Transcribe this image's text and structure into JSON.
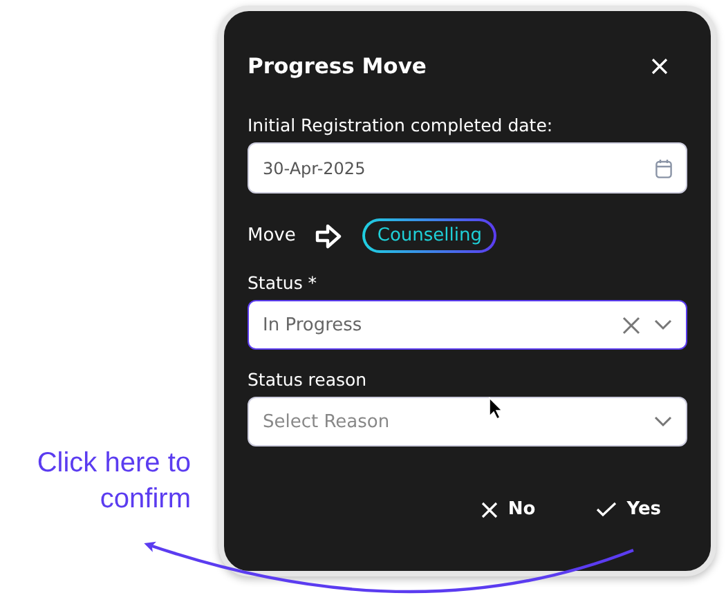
{
  "dialog": {
    "title": "Progress Move",
    "date_field": {
      "label": "Initial Registration completed date:",
      "value": "30-Apr-2025"
    },
    "move": {
      "label": "Move",
      "stage": "Counselling"
    },
    "status": {
      "label": "Status *",
      "value": "In Progress",
      "focused": true
    },
    "status_reason": {
      "label": "Status reason",
      "placeholder": "Select Reason"
    },
    "buttons": [
      {
        "label": "No",
        "kind": "cancel"
      },
      {
        "label": "Yes",
        "kind": "confirm"
      }
    ]
  },
  "annotation": {
    "text": "Click here to confirm"
  }
}
